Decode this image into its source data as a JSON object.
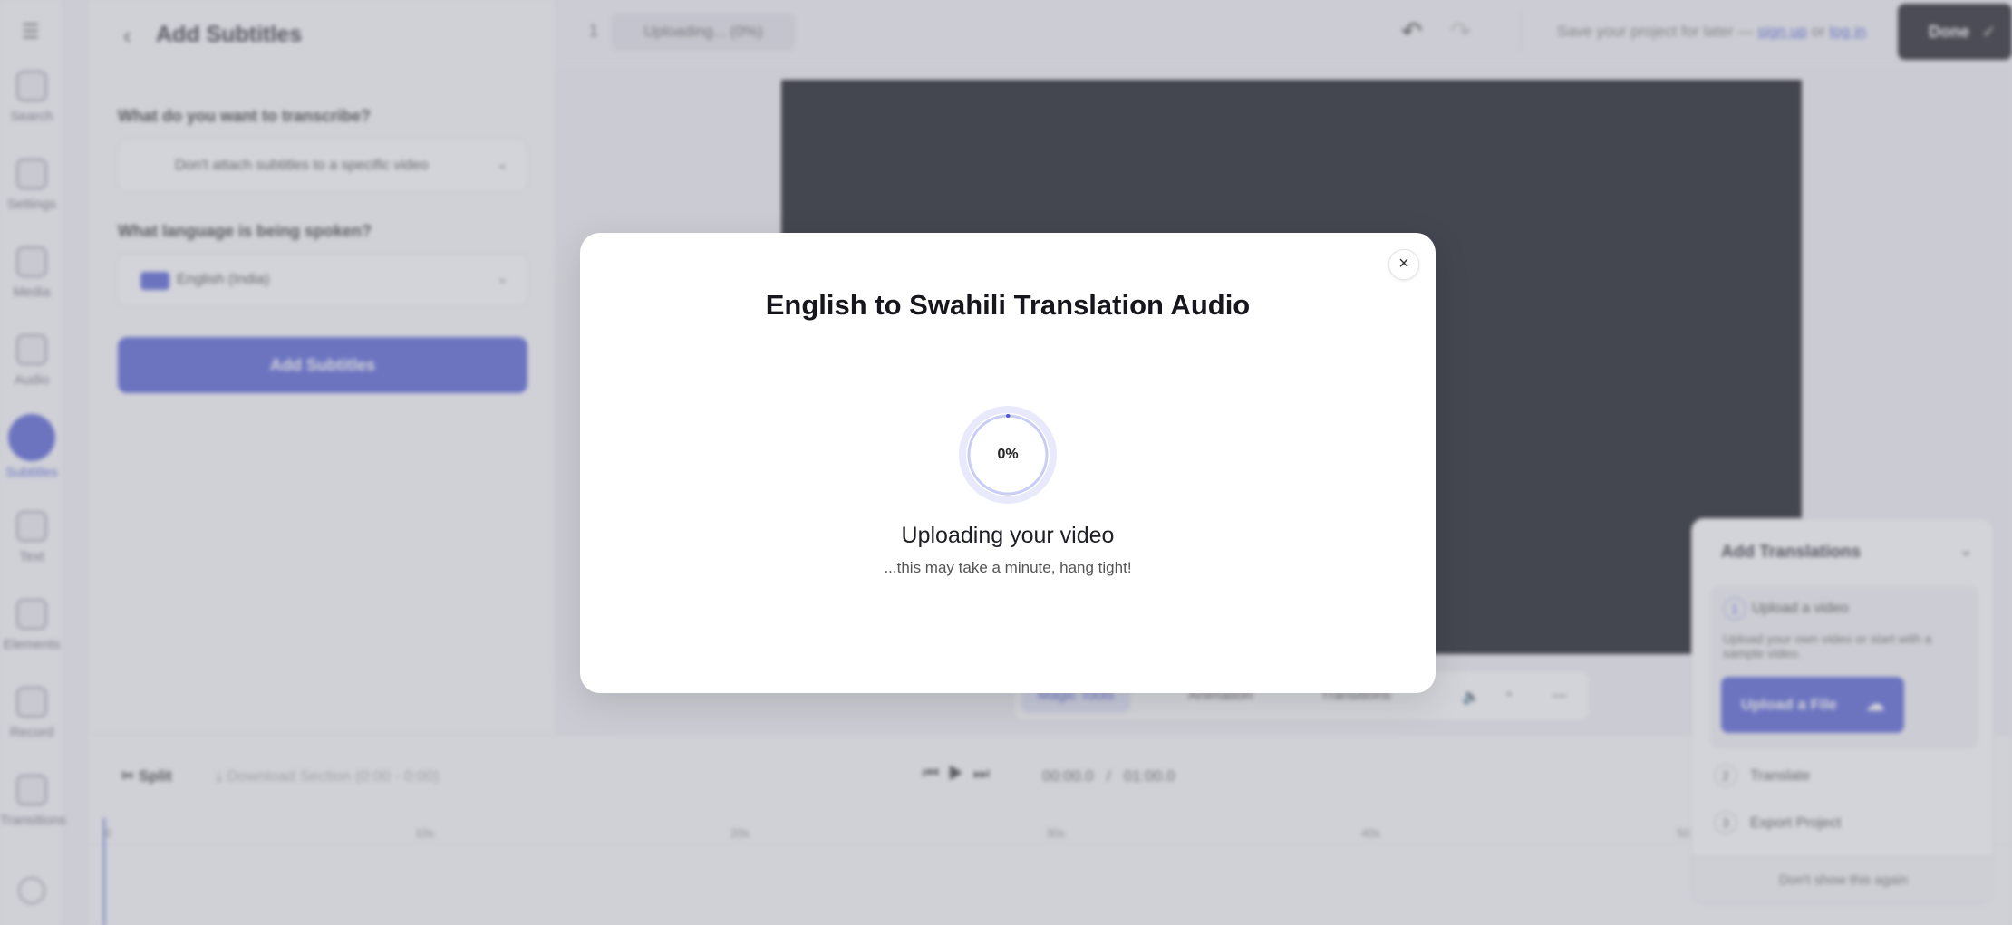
{
  "rail": {
    "items": [
      {
        "label": "Search",
        "icon": "search-icon"
      },
      {
        "label": "Settings",
        "icon": "gear-icon"
      },
      {
        "label": "Media",
        "icon": "media-icon"
      },
      {
        "label": "Audio",
        "icon": "audio-icon"
      },
      {
        "label": "Subtitles",
        "icon": "subtitles-icon",
        "active": true
      },
      {
        "label": "Text",
        "icon": "text-icon"
      },
      {
        "label": "Elements",
        "icon": "elements-icon"
      },
      {
        "label": "Record",
        "icon": "record-icon"
      },
      {
        "label": "Transitions",
        "icon": "transitions-icon"
      }
    ]
  },
  "panel": {
    "title": "Add Subtitles",
    "transcribe_label": "What do you want to transcribe?",
    "transcribe_value": "Don't attach subtitles to a specific video",
    "language_label": "What language is being spoken?",
    "language_value": "English (India)",
    "add_button": "Add Subtitles"
  },
  "topbar": {
    "project_number": "1",
    "upload_status": "Uploading... (0%)",
    "save_prefix": "Save your project for later —",
    "sign_up": "sign up",
    "or": "or",
    "log_in": "log in",
    "done": "Done"
  },
  "toolstrip": {
    "magic": "Magic Tools",
    "animation": "Animation",
    "transitions": "Transitions"
  },
  "timeline": {
    "split": "Split",
    "download": "Download Section (0:00 - 0:00)",
    "current_time": "00:00.0",
    "separator": "/",
    "total_time": "01:00.0",
    "ticks": [
      "0",
      "10s",
      "20s",
      "30s",
      "40s",
      "50"
    ]
  },
  "translations_panel": {
    "title": "Add Translations",
    "step1_num": "1",
    "step1_label": "Upload a video",
    "step1_desc": "Upload your own video or start with a sample video.",
    "upload_button": "Upload a File",
    "step2_num": "2",
    "step2_label": "Translate",
    "step3_num": "3",
    "step3_label": "Export Project",
    "dismiss": "Don't show this again"
  },
  "modal": {
    "title": "English to Swahili Translation Audio",
    "progress_percent": 0,
    "progress_label": "0%",
    "status": "Uploading your video",
    "subtext": "...this may take a minute, hang tight!"
  },
  "colors": {
    "accent": "#4f5bd5",
    "dark": "#16161c"
  }
}
